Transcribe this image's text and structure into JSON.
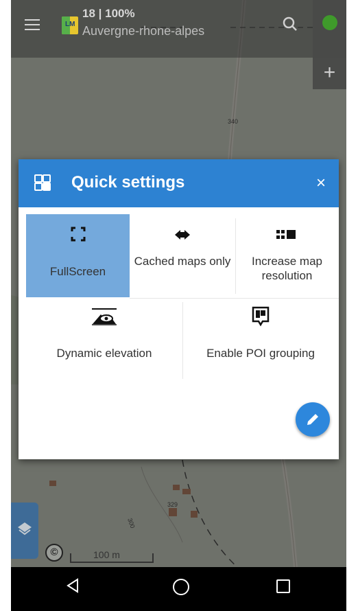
{
  "topbar": {
    "logo_text": "LM",
    "zoom_status": "18 | 100%",
    "region_name": "Auvergne-rhone-alpes"
  },
  "map": {
    "scale_label": "100 m",
    "copyright_symbol": "©",
    "zoom_in_label": "+",
    "labels": [
      "340",
      "329",
      "300"
    ]
  },
  "dialog": {
    "title": "Quick settings",
    "close_label": "×",
    "tiles": [
      {
        "label": "FullScreen",
        "icon": "fullscreen-icon",
        "active": true
      },
      {
        "label": "Cached maps only",
        "icon": "cached-maps-icon",
        "active": false
      },
      {
        "label": "Increase map resolution",
        "icon": "map-resolution-icon",
        "active": false
      },
      {
        "label": "Dynamic elevation",
        "icon": "dynamic-elevation-icon",
        "active": false
      },
      {
        "label": "Enable POI grouping",
        "icon": "poi-grouping-icon",
        "active": false
      }
    ],
    "edit_button_icon": "pencil-icon"
  },
  "colors": {
    "header_blue": "#2d82d2",
    "active_tile": "#74a9dc",
    "fab_blue": "#2d87dc"
  }
}
